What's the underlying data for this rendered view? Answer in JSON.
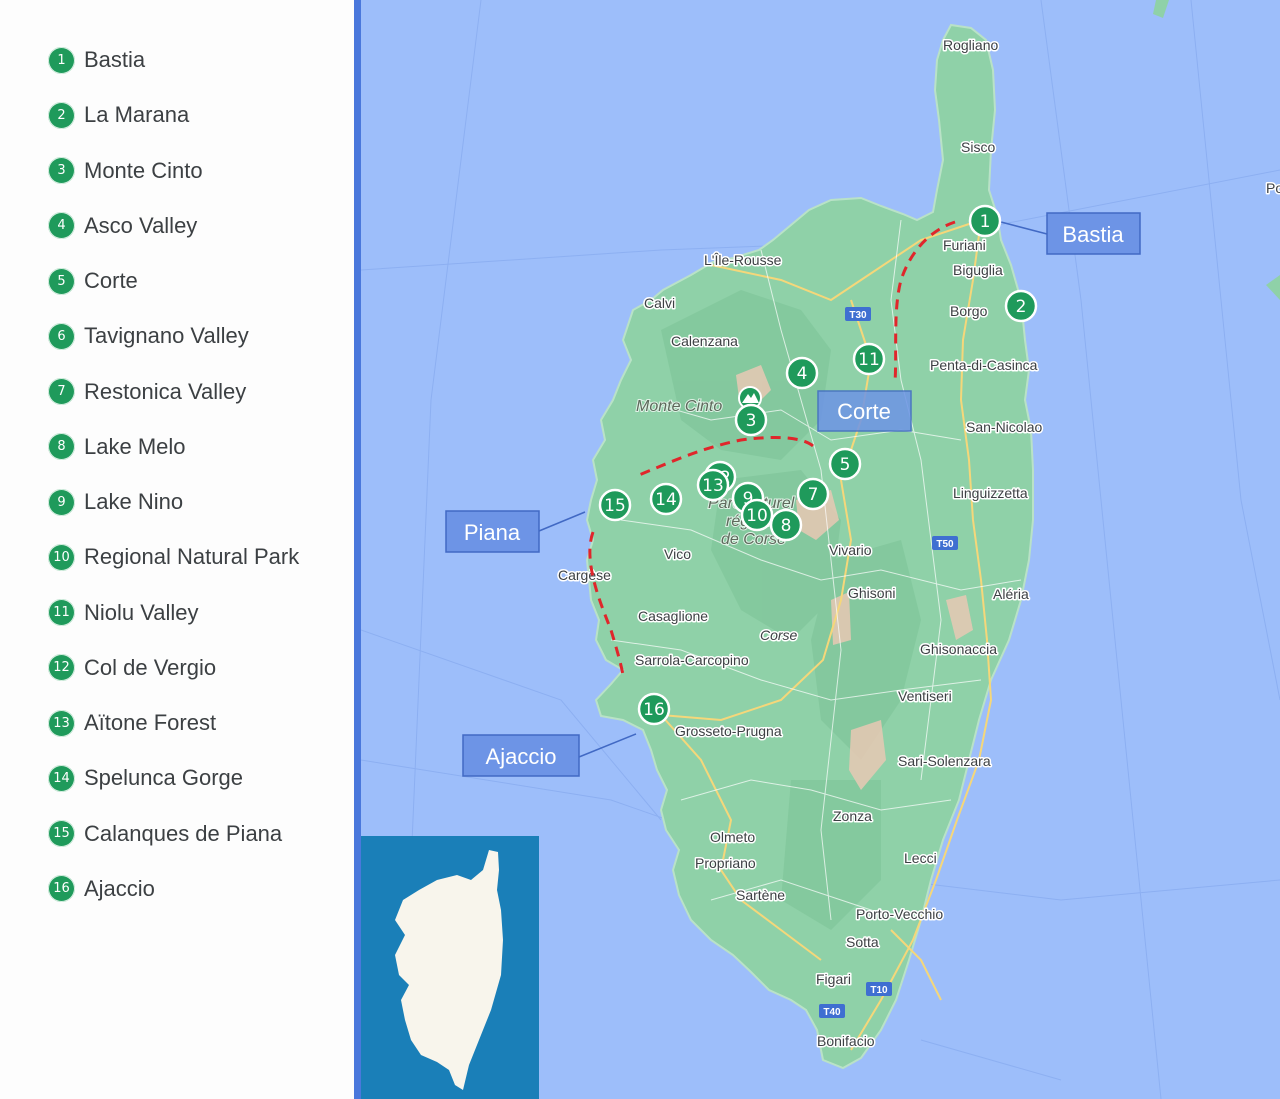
{
  "itinerary": [
    {
      "num": "1",
      "name": "Bastia"
    },
    {
      "num": "2",
      "name": "La Marana"
    },
    {
      "num": "3",
      "name": "Monte Cinto"
    },
    {
      "num": "4",
      "name": "Asco Valley"
    },
    {
      "num": "5",
      "name": "Corte"
    },
    {
      "num": "6",
      "name": "Tavignano Valley"
    },
    {
      "num": "7",
      "name": "Restonica Valley"
    },
    {
      "num": "8",
      "name": "Lake Melo"
    },
    {
      "num": "9",
      "name": "Lake Nino"
    },
    {
      "num": "10",
      "name": "Regional Natural Park"
    },
    {
      "num": "11",
      "name": "Niolu Valley"
    },
    {
      "num": "12",
      "name": "Col de Vergio"
    },
    {
      "num": "13",
      "name": "Aïtone Forest"
    },
    {
      "num": "14",
      "name": "Spelunca Gorge"
    },
    {
      "num": "15",
      "name": "Calanques de Piana"
    },
    {
      "num": "16",
      "name": "Ajaccio"
    }
  ],
  "map": {
    "towns": [
      "Rogliano",
      "Sisco",
      "Furiani",
      "Biguglia",
      "Borgo",
      "Penta-di-Casinca",
      "San-Nicolao",
      "Linguizzetta",
      "Aléria",
      "Ghisonaccia",
      "Ventiseri",
      "Sari-Solenzara",
      "Zonza",
      "Lecci",
      "Porto-Vecchio",
      "Sotta",
      "Figari",
      "Bonifacio",
      "Sartène",
      "Propriano",
      "Olmeto",
      "Grosseto-Prugna",
      "Sarrola-Carcopino",
      "Casaglione",
      "Vico",
      "Cargèse",
      "Calvi",
      "L'Île-Rousse",
      "Calenzana",
      "Vivario",
      "Ghisoni",
      "Corse"
    ],
    "region_labels": [
      "Monte Cinto",
      "Parc naturel",
      "régional",
      "de Corse"
    ],
    "road_shields": [
      "T30",
      "T50",
      "T10",
      "T40"
    ],
    "callouts": [
      "Bastia",
      "Corte",
      "Piana",
      "Ajaccio"
    ],
    "edge_label": "Po",
    "colors": {
      "sea": "#9dbefa",
      "land": "#8fd1a8",
      "marker": "#1f9a5b",
      "callout": "#6d94e6",
      "route": "#e0262b",
      "inset_sea": "#1a7fb8",
      "inset_land": "#f8f5ec"
    }
  }
}
